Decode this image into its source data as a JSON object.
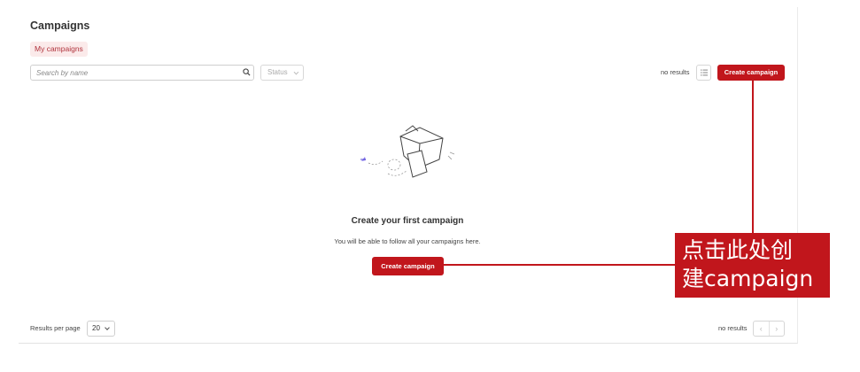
{
  "page": {
    "title": "Campaigns"
  },
  "tabs": {
    "my_campaigns": "My campaigns"
  },
  "filters": {
    "search_placeholder": "Search by name",
    "status_label": "Status"
  },
  "toolbar": {
    "no_results": "no results",
    "create_label": "Create campaign"
  },
  "empty_state": {
    "title": "Create your first campaign",
    "subtitle": "You will be able to follow all your campaigns here.",
    "create_label": "Create campaign"
  },
  "footer": {
    "rpp_label": "Results per page",
    "rpp_value": "20",
    "no_results": "no results",
    "prev_glyph": "‹",
    "next_glyph": "›"
  },
  "annotation": {
    "line1": "点击此处创",
    "line2": "建campaign"
  },
  "colors": {
    "accent": "#c1161c",
    "tab_bg": "#fbeaea"
  }
}
